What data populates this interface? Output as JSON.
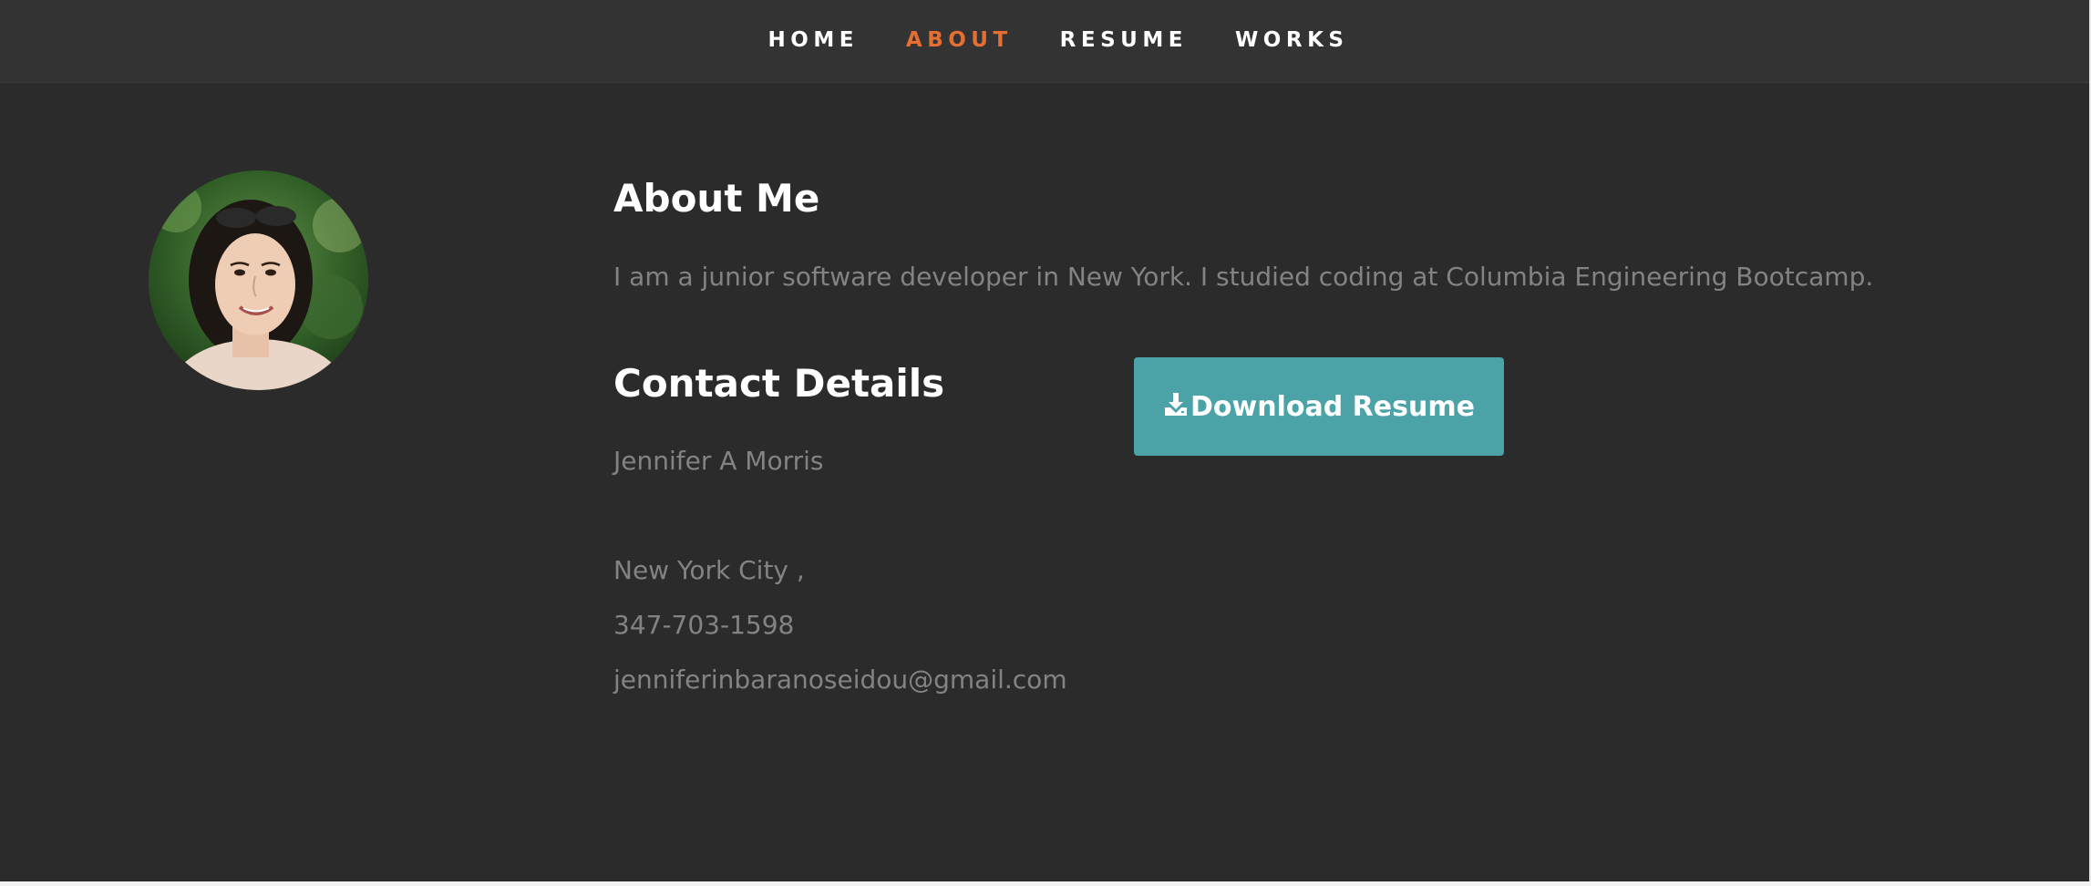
{
  "nav": {
    "items": [
      {
        "label": "HOME",
        "active": false
      },
      {
        "label": "ABOUT",
        "active": true
      },
      {
        "label": "RESUME",
        "active": false
      },
      {
        "label": "WORKS",
        "active": false
      }
    ],
    "active_color": "#e56f32"
  },
  "profile": {
    "avatar_alt": "profile-photo"
  },
  "about": {
    "heading": "About Me",
    "text": "I am a junior software developer in New York. I studied coding at Columbia Engineering Bootcamp."
  },
  "contact": {
    "heading": "Contact Details",
    "name": "Jennifer A Morris",
    "city": "New York City ,",
    "phone": "347-703-1598",
    "email": "jenniferinbaranoseidou@gmail.com"
  },
  "download": {
    "label": "Download Resume",
    "icon": "download-icon",
    "color": "#4ba3a8"
  },
  "colors": {
    "background": "#2b2b2b",
    "nav_background": "#333333",
    "text_muted": "#838383"
  }
}
